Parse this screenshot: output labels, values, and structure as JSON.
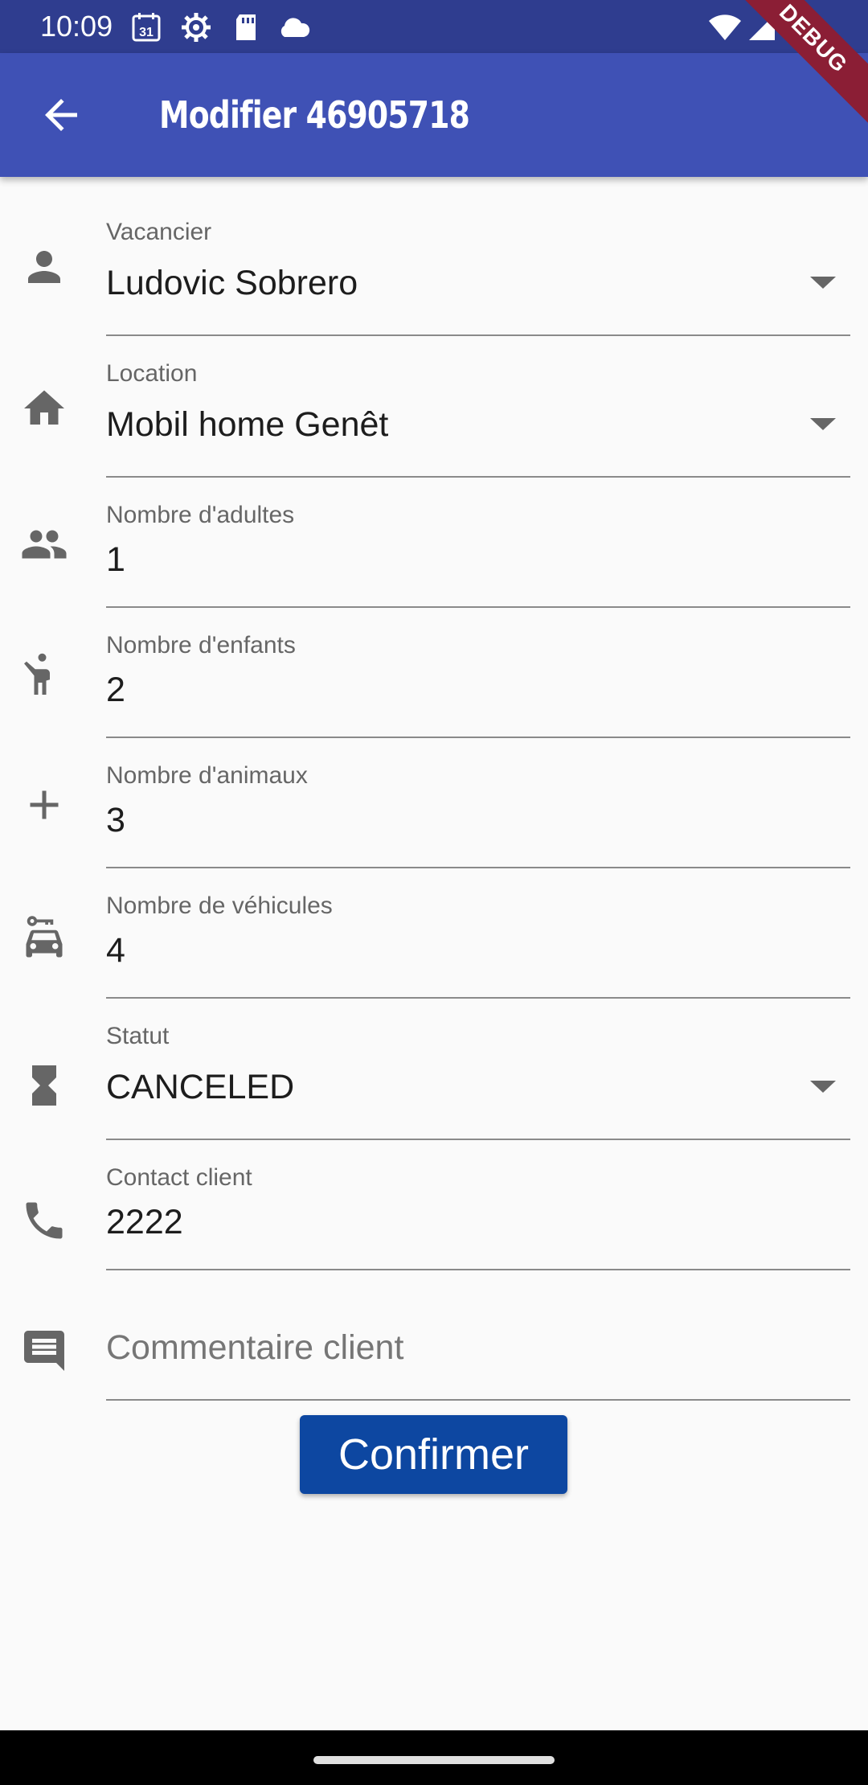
{
  "status_bar": {
    "time": "10:09",
    "calendar_day": "31",
    "icons": [
      "calendar-icon",
      "settings-icon",
      "sd-card-icon",
      "cloud-icon",
      "wifi-icon",
      "signal-icon",
      "battery-icon"
    ]
  },
  "app_bar": {
    "title": "Modifier 46905718",
    "debug_banner": "DEBUG"
  },
  "form": {
    "vacancier": {
      "label": "Vacancier",
      "value": "Ludovic Sobrero",
      "icon": "person-icon"
    },
    "location": {
      "label": "Location",
      "value": "Mobil home Genêt",
      "icon": "home-icon"
    },
    "adultes": {
      "label": "Nombre d'adultes",
      "value": "1",
      "icon": "people-icon"
    },
    "enfants": {
      "label": "Nombre d'enfants",
      "value": "2",
      "icon": "child-icon"
    },
    "animaux": {
      "label": "Nombre d'animaux",
      "value": "3",
      "icon": "plus-icon"
    },
    "vehicules": {
      "label": "Nombre de véhicules",
      "value": "4",
      "icon": "car-rental-icon"
    },
    "statut": {
      "label": "Statut",
      "value": "CANCELED",
      "icon": "hourglass-icon"
    },
    "contact": {
      "label": "Contact client",
      "value": "2222",
      "icon": "phone-icon"
    },
    "commentaire": {
      "placeholder": "Commentaire client",
      "value": "",
      "icon": "comment-icon"
    }
  },
  "confirm_button": {
    "label": "Confirmer"
  },
  "colors": {
    "status_bar": "#2f3d8f",
    "app_bar": "#3f51b5",
    "button": "#0d47a1",
    "debug_banner": "#8b1e35",
    "icon": "#666666"
  }
}
